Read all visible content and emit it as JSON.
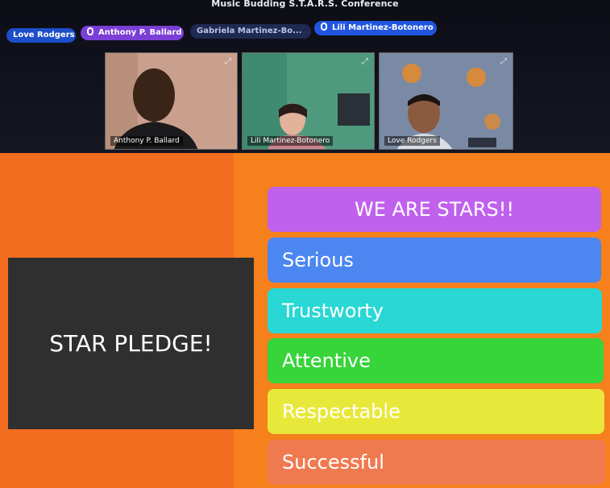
{
  "window": {
    "title": "Music Budding S.T.A.R.S. Conference"
  },
  "participants_bar": [
    {
      "label": "Love Rodgers",
      "bg": "#1d4ec8",
      "fg": "#ffffff",
      "has_mic": false
    },
    {
      "label": "Anthony P. Ballard",
      "bg": "#7a3fd6",
      "fg": "#ffffff",
      "has_mic": true
    },
    {
      "label": "Gabriela Martinez-Bo...",
      "bg": "#1f2a52",
      "fg": "#b9c3e6",
      "has_mic": false
    },
    {
      "label": "Lili Martinez-Botonero",
      "bg": "#2155e0",
      "fg": "#ffffff",
      "has_mic": true
    }
  ],
  "video_tiles": [
    {
      "name": "Anthony P. Ballard"
    },
    {
      "name": "Lili Martinez-Botonero"
    },
    {
      "name": "Love Rodgers"
    }
  ],
  "slide": {
    "pledge_text": "STAR PLEDGE!",
    "header": {
      "text": "WE ARE STARS!!",
      "color": "#c061ee"
    },
    "items": [
      {
        "text": "Serious",
        "color": "#4c86f0"
      },
      {
        "text": "Trustworty",
        "color": "#29d7d4"
      },
      {
        "text": "Attentive",
        "color": "#37d43a"
      },
      {
        "text": "Respectable",
        "color": "#e8e83a"
      },
      {
        "text": "Successful",
        "color": "#f07a50"
      }
    ]
  }
}
